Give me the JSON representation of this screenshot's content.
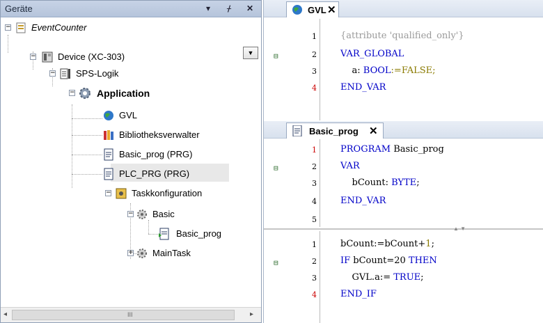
{
  "device_panel": {
    "title": "Geräte",
    "buttons": {
      "dropdown": "▾",
      "pin": "ᚋ",
      "close": "✕"
    },
    "tree": [
      {
        "key": "project",
        "label": "EventCounter",
        "icon": "project-icon"
      },
      {
        "key": "device",
        "label": "Device (XC-303)",
        "icon": "device-icon"
      },
      {
        "key": "plc_logic",
        "label": "SPS-Logik",
        "icon": "plc-logic-icon"
      },
      {
        "key": "application",
        "label": "Application",
        "icon": "application-gear-icon"
      },
      {
        "key": "gvl",
        "label": "GVL",
        "icon": "gvl-globe-icon"
      },
      {
        "key": "library",
        "label": "Bibliotheksverwalter",
        "icon": "library-books-icon"
      },
      {
        "key": "basic_prog",
        "label": "Basic_prog (PRG)",
        "icon": "program-page-icon"
      },
      {
        "key": "plc_prg",
        "label": "PLC_PRG (PRG)",
        "icon": "program-page-icon"
      },
      {
        "key": "tasks",
        "label": "Taskkonfiguration",
        "icon": "task-config-icon"
      },
      {
        "key": "basic_task",
        "label": "Basic",
        "icon": "task-icon"
      },
      {
        "key": "basic_call",
        "label": "Basic_prog",
        "icon": "program-call-icon"
      },
      {
        "key": "maintask",
        "label": "MainTask",
        "icon": "task-icon"
      }
    ],
    "scroll": {
      "left": "◂",
      "right": "▸",
      "grip": "III"
    }
  },
  "editors": {
    "gvl_tab": {
      "label": "GVL",
      "close": "✕"
    },
    "gvl_lines": [
      {
        "n": "1",
        "t1": "{attribute 'qualified_only'}",
        "t2": "",
        "t3": ""
      },
      {
        "n": "2",
        "t1": "VAR_GLOBAL",
        "t2": "",
        "t3": ""
      },
      {
        "n": "3",
        "t1": "    a: ",
        "t2": "BOOL",
        "t3": ":=FALSE;"
      },
      {
        "n": "4",
        "t1": "END_VAR",
        "t2": "",
        "t3": ""
      }
    ],
    "basic_tab": {
      "label": "Basic_prog",
      "close": "✕"
    },
    "decl_lines": [
      {
        "n": "1",
        "t1": "PROGRAM",
        "t2": " Basic_prog",
        "t3": ""
      },
      {
        "n": "2",
        "t1": "VAR",
        "t2": "",
        "t3": ""
      },
      {
        "n": "3",
        "t1": "    bCount: ",
        "t2": "BYTE",
        "t3": ";"
      },
      {
        "n": "4",
        "t1": "END_VAR",
        "t2": "",
        "t3": ""
      },
      {
        "n": "5",
        "t1": "",
        "t2": "",
        "t3": ""
      }
    ],
    "impl_lines": [
      {
        "n": "1",
        "t1": "bCount:=bCount+",
        "t2": "1",
        "t3": ";"
      },
      {
        "n": "2",
        "t1": "IF",
        "t2": " bCount=20 ",
        "t3": "THEN"
      },
      {
        "n": "3",
        "t1": "    GVL.a:= ",
        "t2": "TRUE",
        "t3": ";"
      },
      {
        "n": "4",
        "t1": "END_IF",
        "t2": "",
        "t3": ""
      }
    ],
    "fold_marker": "⊟",
    "splitter_marks": "▲ ▼"
  }
}
